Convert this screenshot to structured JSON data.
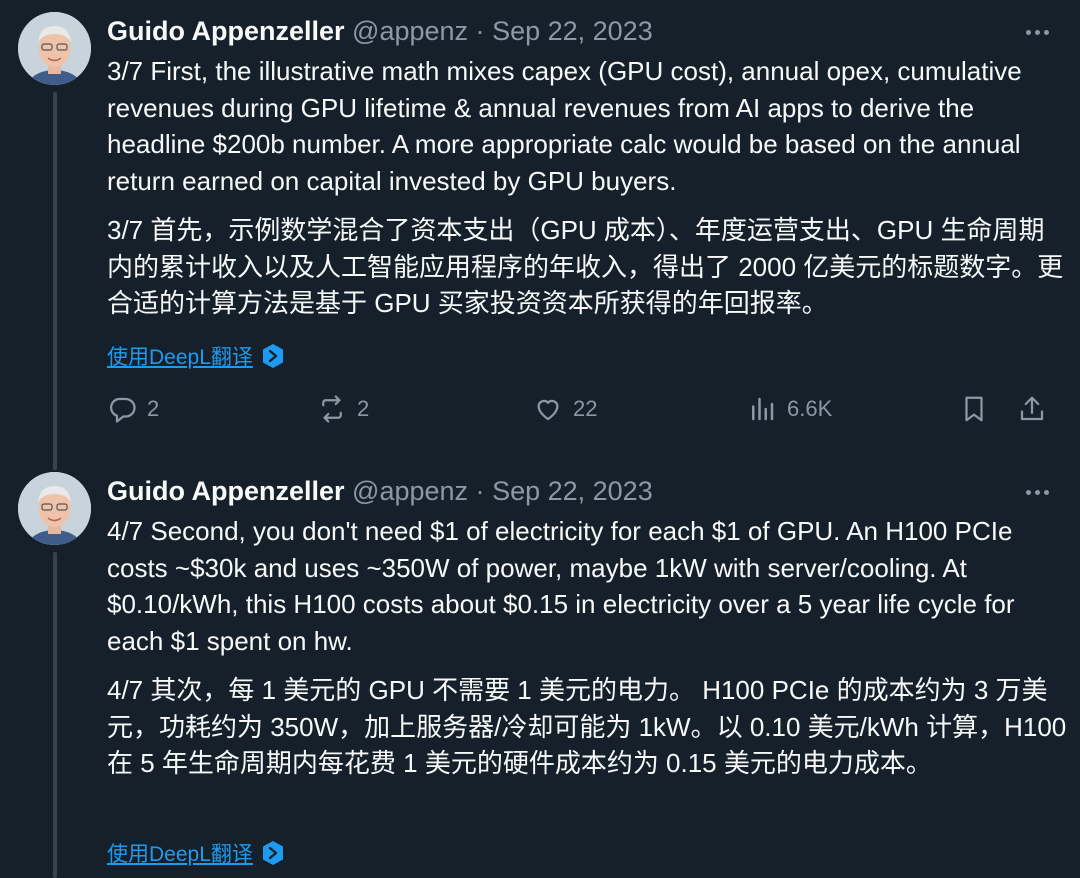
{
  "tweets": [
    {
      "author_name": "Guido Appenzeller",
      "handle": "@appenz",
      "separator": "·",
      "date": "Sep 22, 2023",
      "text_en": "3/7 First, the illustrative math mixes capex (GPU cost), annual opex, cumulative revenues during GPU lifetime & annual revenues from AI apps to derive the headline $200b number. A more appropriate calc would be based on the annual return earned on capital invested by GPU buyers.",
      "text_zh": "3/7 首先，示例数学混合了资本支出（GPU 成本）、年度运营支出、GPU 生命周期内的累计收入以及人工智能应用程序的年收入，得出了 2000 亿美元的标题数字。更合适的计算方法是基于 GPU 买家投资资本所获得的年回报率。",
      "translate_label": "使用DeepL翻译",
      "replies": "2",
      "reposts": "2",
      "likes": "22",
      "views": "6.6K"
    },
    {
      "author_name": "Guido Appenzeller",
      "handle": "@appenz",
      "separator": "·",
      "date": "Sep 22, 2023",
      "text_en": "4/7 Second, you don't need $1 of electricity for each $1 of GPU. An H100 PCIe costs ~$30k and uses ~350W of power, maybe 1kW with server/cooling. At $0.10/kWh, this H100 costs about $0.15 in electricity over a 5 year life cycle for each $1 spent on hw.",
      "text_zh": "4/7 其次，每 1 美元的 GPU 不需要 1 美元的电力。 H100 PCIe 的成本约为 3 万美元，功耗约为 350W，加上服务器/冷却可能为 1kW。以 0.10 美元/kWh 计算，H100 在 5 年生命周期内每花费 1 美元的硬件成本约为 0.15 美元的电力成本。",
      "translate_label": "使用DeepL翻译"
    }
  ],
  "icons": {
    "reply": "reply-icon",
    "repost": "repost-icon",
    "like": "heart-icon",
    "views": "views-icon",
    "bookmark": "bookmark-icon",
    "share": "share-icon",
    "more": "more-icon",
    "deepl": "deepl-icon"
  },
  "colors": {
    "background": "#15202b",
    "text": "#f7f9f9",
    "muted": "#8b98a5",
    "link": "#1d9bf0",
    "thread_line": "#38444d"
  }
}
